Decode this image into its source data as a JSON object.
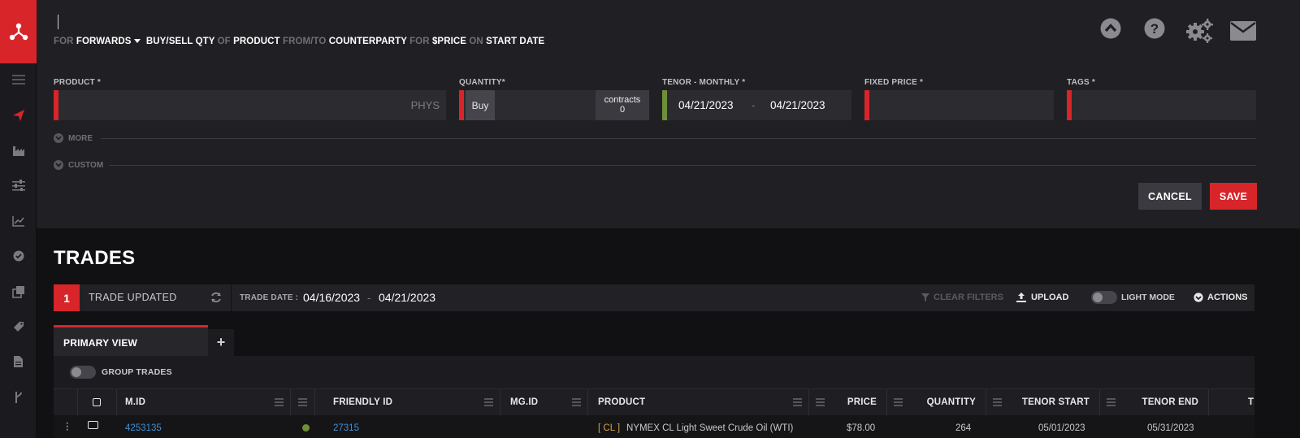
{
  "form": {
    "sentence": {
      "for1": "FOR",
      "instrument": "FORWARDS",
      "buy_sell_qty": "BUY/SELL QTY",
      "of": "OF",
      "product": "PRODUCT",
      "from_to": "FROM/TO",
      "counterparty": "COUNTERPARTY",
      "for2": "FOR",
      "price": "$PRICE",
      "on": "ON",
      "start_date": "START DATE"
    },
    "product_label": "PRODUCT *",
    "product_value": "",
    "product_placeholder": "PHYS",
    "quantity_label": "QUANTITY*",
    "buy_label": "Buy",
    "quantity_value": "",
    "contracts_unit": "contracts",
    "contracts_count": "0",
    "tenor_label": "TENOR - MONTHLY *",
    "tenor_start": "04/21/2023",
    "tenor_sep": "-",
    "tenor_end": "04/21/2023",
    "fixed_price_label": "FIXED PRICE *",
    "fixed_price_value": "",
    "tags_label": "TAGS *",
    "tags_value": "",
    "more_label": "MORE",
    "custom_label": "CUSTOM",
    "cancel_label": "CANCEL",
    "save_label": "SAVE"
  },
  "trades": {
    "title": "TRADES",
    "updated_count": "1",
    "updated_text": "TRADE UPDATED",
    "trade_date_label": "TRADE DATE :",
    "trade_date_from": "04/16/2023",
    "trade_date_sep": "-",
    "trade_date_to": "04/21/2023",
    "clear_filters": "CLEAR FILTERS",
    "upload": "UPLOAD",
    "light_mode": "LIGHT MODE",
    "actions": "ACTIONS",
    "tabs": [
      {
        "label": "PRIMARY VIEW"
      }
    ],
    "add_tab": "+",
    "group_trades": "GROUP TRADES",
    "columns": [
      "M.ID",
      "FRIENDLY ID",
      "MG.ID",
      "PRODUCT",
      "PRICE",
      "QUANTITY",
      "TENOR START",
      "TENOR END",
      "T"
    ],
    "row": {
      "mid": "4253135",
      "friendly_id": "27315",
      "product_code": "[ CL ]",
      "product_name": "NYMEX CL Light Sweet Crude Oil (WTI)",
      "price": "$78.00",
      "quantity": "264",
      "tenor_start": "05/01/2023",
      "tenor_end": "05/31/2023"
    }
  },
  "colors": {
    "accent_red": "#d7252a",
    "ok_green": "#6e8f3a",
    "link_blue": "#3f8fd6"
  },
  "icons": [
    "logo-icon",
    "hamburger-icon",
    "paper-plane-icon",
    "factory-icon",
    "sliders-icon",
    "line-chart-icon",
    "check-circle-icon",
    "layers-icon",
    "tag-icon",
    "document-icon",
    "branch-icon",
    "chevron-up-circle-icon",
    "help-circle-icon",
    "gears-icon",
    "envelope-icon",
    "refresh-icon",
    "filter-icon",
    "upload-icon",
    "chevron-down-circle-icon"
  ]
}
